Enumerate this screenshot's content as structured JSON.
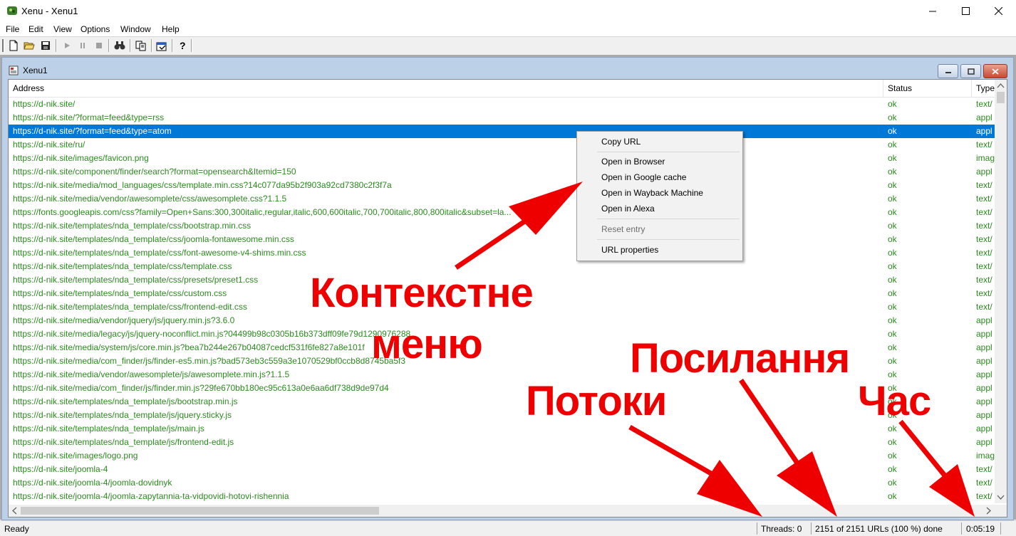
{
  "window": {
    "title": "Xenu - Xenu1",
    "minimize_glyph": "—",
    "maximize_glyph": "☐",
    "close_glyph": "✕"
  },
  "menubar": {
    "items": [
      "File",
      "Edit",
      "View",
      "Options",
      "Window",
      "Help"
    ]
  },
  "toolbar": {
    "buttons": [
      "new-icon",
      "open-icon",
      "save-icon",
      "play-icon",
      "pause-icon",
      "stop-icon",
      "find-icon",
      "copy-icon",
      "properties-icon",
      "help-icon"
    ]
  },
  "child_window": {
    "title": "Xenu1"
  },
  "listview": {
    "columns": [
      "Address",
      "Status",
      "Type"
    ],
    "rows": [
      {
        "address": "https://d-nik.site/",
        "status": "ok",
        "type": "text/"
      },
      {
        "address": "https://d-nik.site/?format=feed&type=rss",
        "status": "ok",
        "type": "appl"
      },
      {
        "address": "https://d-nik.site/?format=feed&type=atom",
        "status": "ok",
        "type": "appl",
        "selected": true
      },
      {
        "address": "https://d-nik.site/ru/",
        "status": "ok",
        "type": "text/"
      },
      {
        "address": "https://d-nik.site/images/favicon.png",
        "status": "ok",
        "type": "imag"
      },
      {
        "address": "https://d-nik.site/component/finder/search?format=opensearch&Itemid=150",
        "status": "ok",
        "type": "appl"
      },
      {
        "address": "https://d-nik.site/media/mod_languages/css/template.min.css?14c077da95b2f903a92cd7380c2f3f7a",
        "status": "ok",
        "type": "text/"
      },
      {
        "address": "https://d-nik.site/media/vendor/awesomplete/css/awesomplete.css?1.1.5",
        "status": "ok",
        "type": "text/"
      },
      {
        "address": "https://fonts.googleapis.com/css?family=Open+Sans:300,300italic,regular,italic,600,600italic,700,700italic,800,800italic&subset=la...",
        "status": "ok",
        "type": "text/"
      },
      {
        "address": "https://d-nik.site/templates/nda_template/css/bootstrap.min.css",
        "status": "ok",
        "type": "text/"
      },
      {
        "address": "https://d-nik.site/templates/nda_template/css/joomla-fontawesome.min.css",
        "status": "ok",
        "type": "text/"
      },
      {
        "address": "https://d-nik.site/templates/nda_template/css/font-awesome-v4-shims.min.css",
        "status": "ok",
        "type": "text/"
      },
      {
        "address": "https://d-nik.site/templates/nda_template/css/template.css",
        "status": "ok",
        "type": "text/"
      },
      {
        "address": "https://d-nik.site/templates/nda_template/css/presets/preset1.css",
        "status": "ok",
        "type": "text/"
      },
      {
        "address": "https://d-nik.site/templates/nda_template/css/custom.css",
        "status": "ok",
        "type": "text/"
      },
      {
        "address": "https://d-nik.site/templates/nda_template/css/frontend-edit.css",
        "status": "ok",
        "type": "text/"
      },
      {
        "address": "https://d-nik.site/media/vendor/jquery/js/jquery.min.js?3.6.0",
        "status": "ok",
        "type": "appl"
      },
      {
        "address": "https://d-nik.site/media/legacy/js/jquery-noconflict.min.js?04499b98c0305b16b373dff09fe79d1290976288",
        "status": "ok",
        "type": "appl"
      },
      {
        "address": "https://d-nik.site/media/system/js/core.min.js?bea7b244e267b04087cedcf531f6fe827a8e101f",
        "status": "ok",
        "type": "appl"
      },
      {
        "address": "https://d-nik.site/media/com_finder/js/finder-es5.min.js?bad573eb3c559a3e1070529bf0ccb8d8745ba5f3",
        "status": "ok",
        "type": "appl"
      },
      {
        "address": "https://d-nik.site/media/vendor/awesomplete/js/awesomplete.min.js?1.1.5",
        "status": "ok",
        "type": "appl"
      },
      {
        "address": "https://d-nik.site/media/com_finder/js/finder.min.js?29fe670bb180ec95c613a0e6aa6df738d9de97d4",
        "status": "ok",
        "type": "appl"
      },
      {
        "address": "https://d-nik.site/templates/nda_template/js/bootstrap.min.js",
        "status": "ok",
        "type": "appl"
      },
      {
        "address": "https://d-nik.site/templates/nda_template/js/jquery.sticky.js",
        "status": "ok",
        "type": "appl"
      },
      {
        "address": "https://d-nik.site/templates/nda_template/js/main.js",
        "status": "ok",
        "type": "appl"
      },
      {
        "address": "https://d-nik.site/templates/nda_template/js/frontend-edit.js",
        "status": "ok",
        "type": "appl"
      },
      {
        "address": "https://d-nik.site/images/logo.png",
        "status": "ok",
        "type": "imag"
      },
      {
        "address": "https://d-nik.site/joomla-4",
        "status": "ok",
        "type": "text/"
      },
      {
        "address": "https://d-nik.site/joomla-4/joomla-dovidnyk",
        "status": "ok",
        "type": "text/"
      },
      {
        "address": "https://d-nik.site/joomla-4/joomla-zapytannia-ta-vidpovidi-hotovi-rishennia",
        "status": "ok",
        "type": "text/"
      }
    ]
  },
  "context_menu": {
    "items": [
      {
        "label": "Copy URL",
        "enabled": true
      },
      {
        "label": "Open in Browser",
        "enabled": true
      },
      {
        "label": "Open in Google cache",
        "enabled": true
      },
      {
        "label": "Open in Wayback Machine",
        "enabled": true
      },
      {
        "label": "Open in Alexa",
        "enabled": true
      },
      {
        "label": "Reset entry",
        "enabled": false
      },
      {
        "label": "URL properties",
        "enabled": true
      }
    ]
  },
  "statusbar": {
    "status": "Ready",
    "threads": "Threads: 0",
    "progress": "2151 of 2151 URLs (100 %) done",
    "time": "0:05:19"
  },
  "annotations": {
    "context_menu_line1": "Контекстне",
    "context_menu_line2": "меню",
    "links": "Посилання",
    "threads": "Потоки",
    "time": "Час",
    "color": "#ee0000"
  },
  "colors": {
    "link_green": "#2b8a1e",
    "selection_blue": "#0078d7"
  }
}
